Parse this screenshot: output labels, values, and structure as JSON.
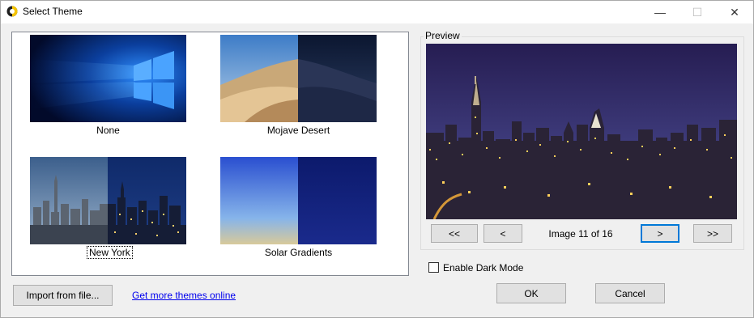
{
  "window": {
    "title": "Select Theme",
    "controls": {
      "minimize": "—",
      "maximize": "☐",
      "close": "✕"
    }
  },
  "themes": [
    {
      "label": "None",
      "thumbnail": "windows-logo-blue"
    },
    {
      "label": "Mojave Desert",
      "thumbnail": "desert-dunes-day-night"
    },
    {
      "label": "New York",
      "thumbnail": "new-york-skyline-day-night",
      "selected": true
    },
    {
      "label": "Solar Gradients",
      "thumbnail": "blue-gradient-day-night"
    }
  ],
  "preview": {
    "group_label": "Preview",
    "image": "new-york-night-skyline",
    "counter": "Image 11 of 16",
    "nav": {
      "first": "<<",
      "prev": "<",
      "next": ">",
      "last": ">>"
    }
  },
  "dark_mode": {
    "label": "Enable Dark Mode",
    "checked": false
  },
  "footer": {
    "import_label": "Import from file...",
    "link_label": "Get more themes online",
    "ok_label": "OK",
    "cancel_label": "Cancel"
  },
  "colors": {
    "accent": "#0078d7",
    "link": "#0000ee",
    "panel_border": "#828790"
  }
}
